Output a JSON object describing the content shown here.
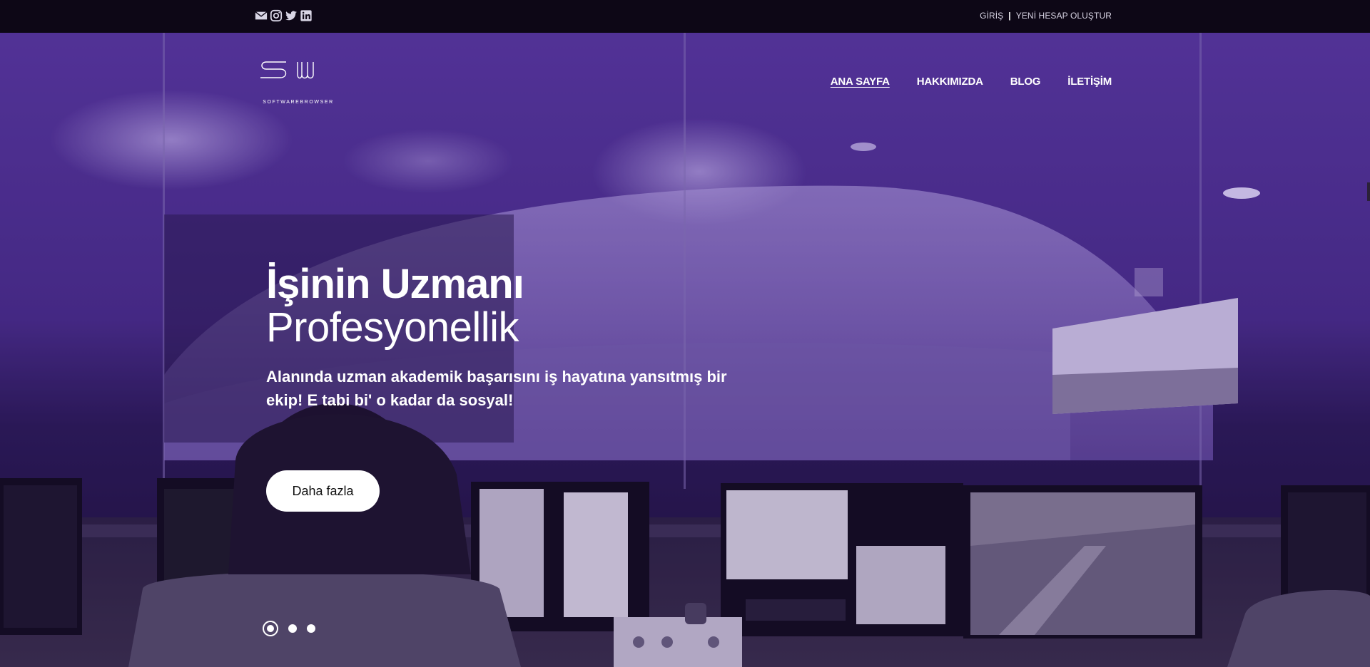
{
  "topbar": {
    "social": [
      {
        "name": "mail-icon"
      },
      {
        "name": "instagram-icon"
      },
      {
        "name": "twitter-icon"
      },
      {
        "name": "linkedin-icon"
      }
    ],
    "login_label": "GİRİŞ",
    "separator": "|",
    "register_label": "YENİ HESAP OLUŞTUR"
  },
  "brand": {
    "logo_text": "SOFTWAREBROWSER"
  },
  "nav": {
    "items": [
      {
        "label": "ANA SAYFA",
        "active": true
      },
      {
        "label": "HAKKIMIZDA",
        "active": false
      },
      {
        "label": "BLOG",
        "active": false
      },
      {
        "label": "İLETİŞİM",
        "active": false
      }
    ]
  },
  "hero": {
    "title": "İşinin Uzmanı",
    "subtitle": "Profesyonellik",
    "lead": "Alanında uzman akademik başarısını iş hayatına yansıtmış bir ekip! E tabi bi' o kadar da sosyal!",
    "cta_label": "Daha fazla",
    "slides": 3,
    "active_slide": 1
  },
  "colors": {
    "topbar_bg": "#0d0716",
    "overlay_purple": "#4d2f93",
    "button_bg": "#ffffff"
  }
}
